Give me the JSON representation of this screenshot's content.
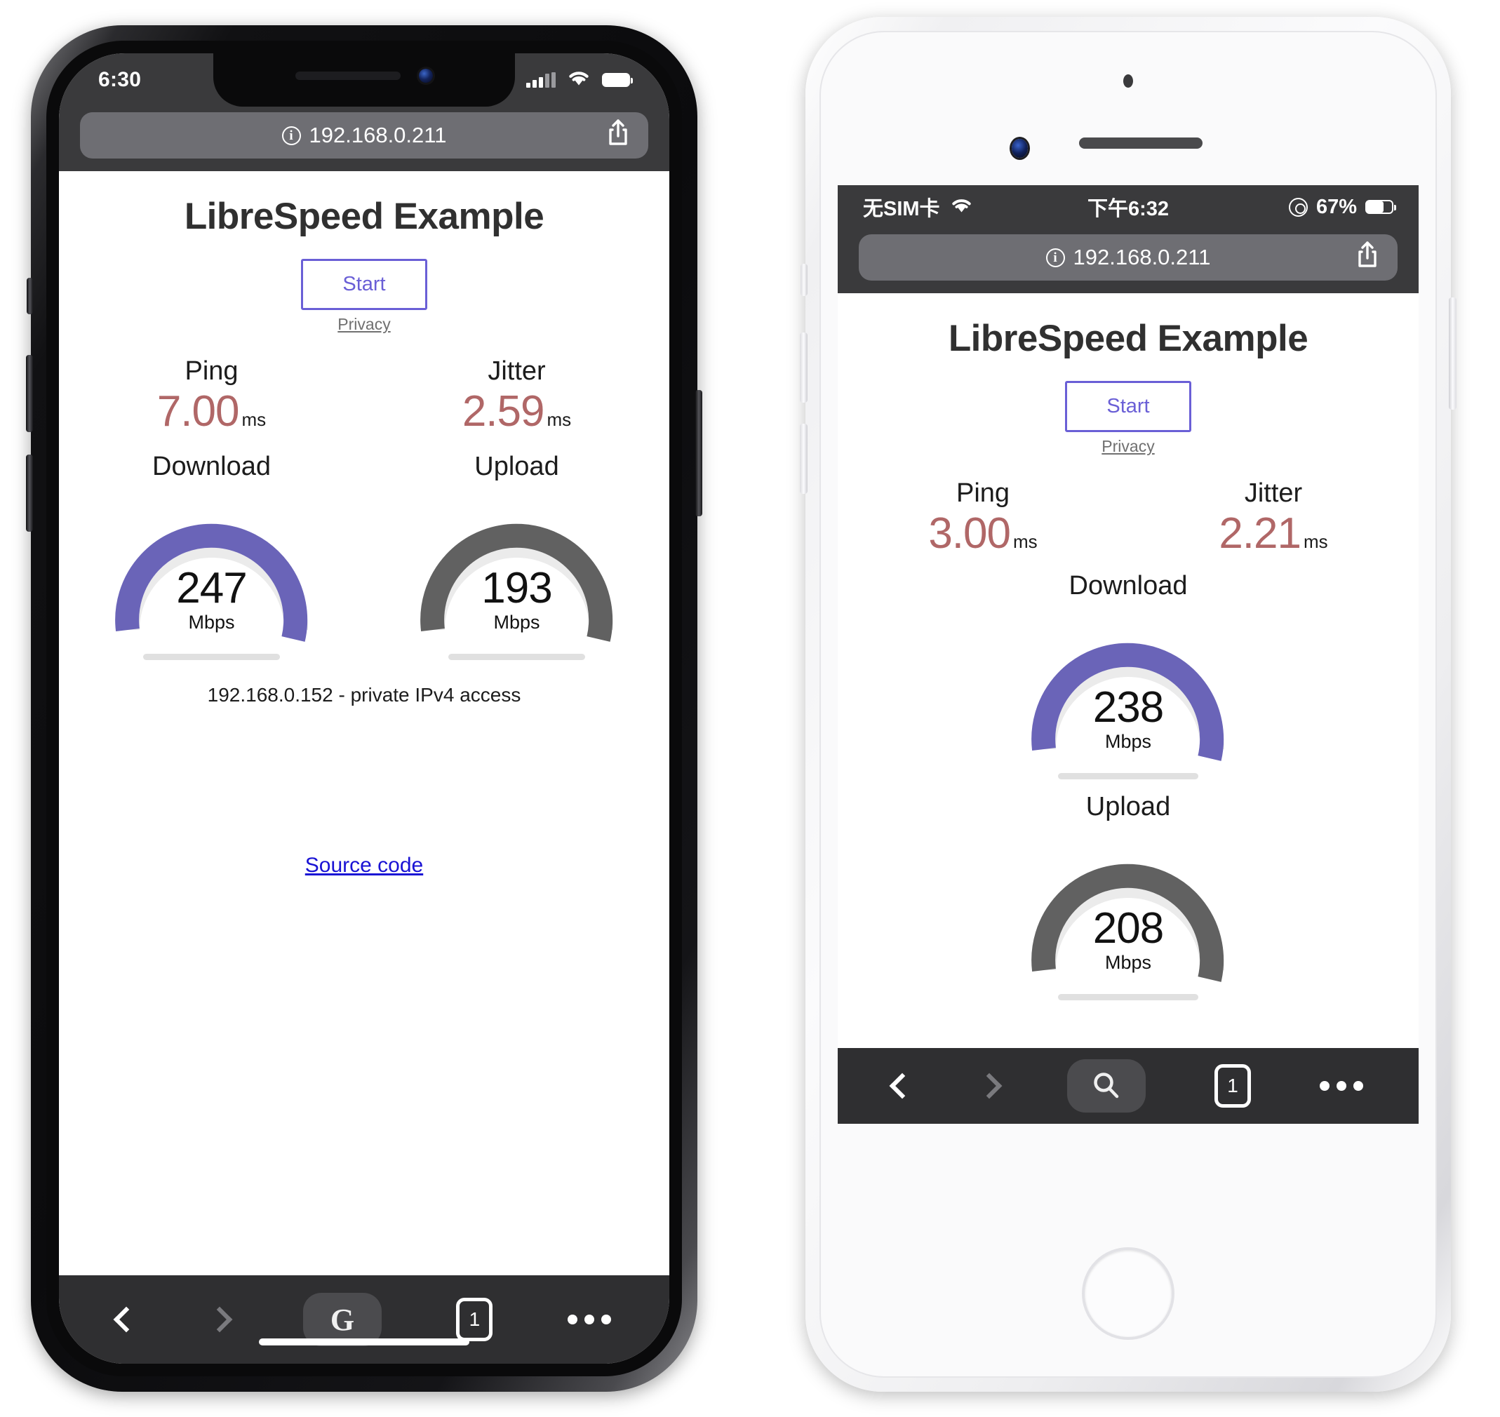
{
  "left_phone": {
    "device": "iphone-x-black",
    "status_bar": {
      "time": "6:30",
      "signal_icon": "cellular-signal-icon",
      "wifi_icon": "wifi-icon",
      "battery_icon": "battery-icon"
    },
    "browser": {
      "url": "192.168.0.211",
      "info_icon": "info-icon",
      "share_icon": "share-icon"
    },
    "page": {
      "title": "LibreSpeed Example",
      "start_label": "Start",
      "privacy_label": "Privacy",
      "ping": {
        "label": "Ping",
        "value": "7.00",
        "unit": "ms"
      },
      "jitter": {
        "label": "Jitter",
        "value": "2.59",
        "unit": "ms"
      },
      "download": {
        "label": "Download",
        "value": "247",
        "unit": "Mbps"
      },
      "upload": {
        "label": "Upload",
        "value": "193",
        "unit": "Mbps"
      },
      "ip_note": "192.168.0.152 - private IPv4 access",
      "source_link": "Source code"
    },
    "toolbar": {
      "back_icon": "chevron-left-icon",
      "forward_icon": "chevron-right-icon",
      "search_engine_label": "G",
      "tabs_count": "1",
      "more_icon": "ellipsis-icon"
    }
  },
  "right_phone": {
    "device": "iphone-8-white",
    "status_bar": {
      "carrier": "无SIM卡",
      "wifi_icon": "wifi-icon",
      "time": "下午6:32",
      "rotation_lock_icon": "rotation-lock-icon",
      "battery_percent": "67%",
      "battery_icon": "battery-icon"
    },
    "browser": {
      "url": "192.168.0.211",
      "info_icon": "info-icon",
      "share_icon": "share-icon"
    },
    "page": {
      "title": "LibreSpeed Example",
      "start_label": "Start",
      "privacy_label": "Privacy",
      "ping": {
        "label": "Ping",
        "value": "3.00",
        "unit": "ms"
      },
      "jitter": {
        "label": "Jitter",
        "value": "2.21",
        "unit": "ms"
      },
      "download": {
        "label": "Download",
        "value": "238",
        "unit": "Mbps"
      },
      "upload": {
        "label": "Upload",
        "value": "208",
        "unit": "Mbps"
      }
    },
    "toolbar": {
      "back_icon": "chevron-left-icon",
      "forward_icon": "chevron-right-icon",
      "search_icon": "search-icon",
      "tabs_count": "1",
      "more_icon": "ellipsis-icon"
    }
  },
  "colors": {
    "download_accent": "#6a64b8",
    "upload_accent": "#616161",
    "ping_value": "#b06767",
    "start_border": "#6a5fd6",
    "gauge_track": "#ebebeb",
    "link": "#1a13d4"
  },
  "chart_data": [
    {
      "type": "gauge",
      "title": "Download",
      "phone": "left",
      "value": 247,
      "unit": "Mbps",
      "arc_fraction": 0.97,
      "color": "#6a64b8"
    },
    {
      "type": "gauge",
      "title": "Upload",
      "phone": "left",
      "value": 193,
      "unit": "Mbps",
      "arc_fraction": 0.97,
      "color": "#616161"
    },
    {
      "type": "gauge",
      "title": "Download",
      "phone": "right",
      "value": 238,
      "unit": "Mbps",
      "arc_fraction": 0.97,
      "color": "#6a64b8"
    },
    {
      "type": "gauge",
      "title": "Upload",
      "phone": "right",
      "value": 208,
      "unit": "Mbps",
      "arc_fraction": 0.97,
      "color": "#616161"
    }
  ]
}
